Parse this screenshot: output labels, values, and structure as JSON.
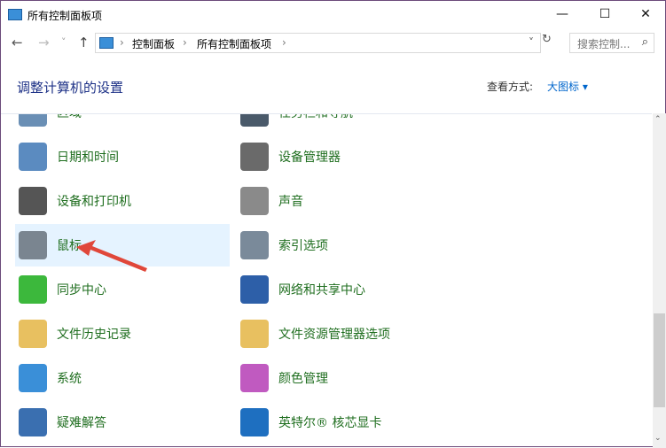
{
  "window": {
    "title": "所有控制面板项",
    "minimize": "—",
    "maximize": "☐",
    "close": "✕"
  },
  "nav": {
    "back": "←",
    "forward": "→",
    "recent": "˅",
    "up": "↑",
    "breadcrumb": [
      "控制面板",
      "所有控制面板项"
    ],
    "separator": "›",
    "dropdown": "˅",
    "refresh": "↻",
    "search_placeholder": "搜索控制...",
    "search_icon": "⌕"
  },
  "header": {
    "title": "调整计算机的设置",
    "view_by_label": "查看方式:",
    "view_by_value": "大图标 ▾"
  },
  "items": [
    {
      "label": "区域",
      "color": "#6a8fb5"
    },
    {
      "label": "任务栏和导航",
      "color": "#4a5a6a"
    },
    {
      "label": "日期和时间",
      "color": "#5b8bc0"
    },
    {
      "label": "设备管理器",
      "color": "#6a6a6a"
    },
    {
      "label": "设备和打印机",
      "color": "#555555"
    },
    {
      "label": "声音",
      "color": "#8a8a8a"
    },
    {
      "label": "鼠标",
      "color": "#7a8590",
      "selected": true
    },
    {
      "label": "索引选项",
      "color": "#7a8a9a"
    },
    {
      "label": "同步中心",
      "color": "#3cb83c"
    },
    {
      "label": "网络和共享中心",
      "color": "#2d5fa8"
    },
    {
      "label": "文件历史记录",
      "color": "#e8c060"
    },
    {
      "label": "文件资源管理器选项",
      "color": "#e8c060"
    },
    {
      "label": "系统",
      "color": "#3a8fd8"
    },
    {
      "label": "颜色管理",
      "color": "#c05ac0"
    },
    {
      "label": "疑难解答",
      "color": "#3a6fb0"
    },
    {
      "label": "英特尔® 核芯显卡",
      "color": "#1e6fc0"
    }
  ],
  "scrollbar": {
    "up": "⌃",
    "down": "⌄"
  }
}
